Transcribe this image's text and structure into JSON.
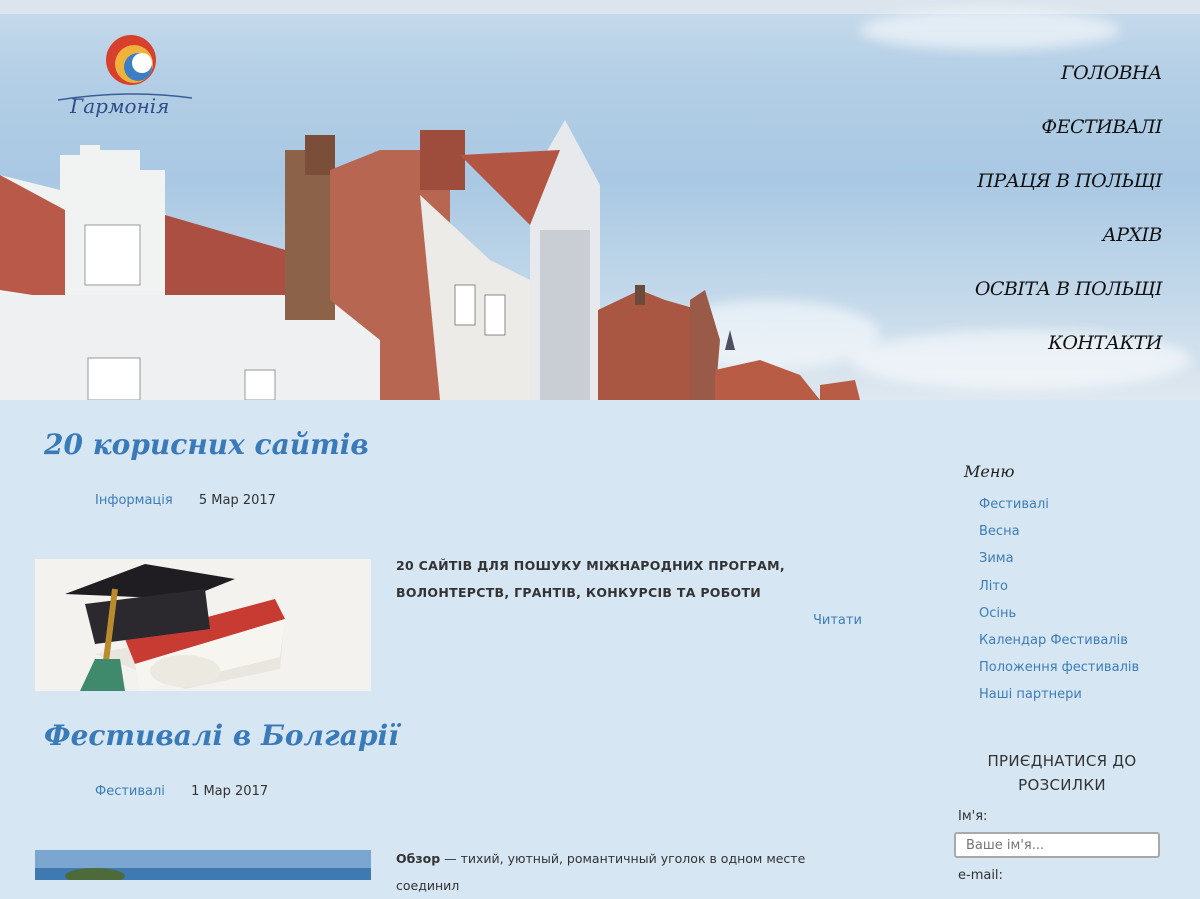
{
  "site": {
    "logo_text": "Гармонія"
  },
  "nav": [
    "ГОЛОВНА",
    "ФЕСТИВАЛІ",
    "ПРАЦЯ В ПОЛЬЩІ",
    "АРХІВ",
    "ОСВІТА В ПОЛЬЩІ",
    "КОНТАКТИ"
  ],
  "posts": [
    {
      "title": "20 корисних сайтів",
      "category": "Інформація",
      "date": "5 Мар 2017",
      "excerpt": "20 САЙТІВ ДЛЯ ПОШУКУ МІЖНАРОДНИХ ПРОГРАМ, ВОЛОНТЕРСТВ, ГРАНТІВ, КОНКУРСІВ ТА РОБОТИ",
      "read_more": "Читати"
    },
    {
      "title": "Фестивалі в Болгарії",
      "category": "Фестивалі",
      "date": "1 Мар 2017",
      "excerpt_bold": "Обзор",
      "excerpt": " — тихий, уютный, романтичный уголок в одном месте соединил"
    }
  ],
  "sidebar": {
    "menu_title": "Меню",
    "menu_items": [
      "Фестивалі",
      "Весна",
      "Зима",
      "Літо",
      "Осінь",
      "Календар Фестивалів",
      "Положення фестивалів",
      "Наші партнери"
    ],
    "subscribe_title": "ПРИЄДНАТИСЯ ДО РОЗСИЛКИ",
    "name_label": "Ім'я:",
    "name_placeholder": "Ваше ім'я...",
    "email_label": "e-mail:"
  }
}
